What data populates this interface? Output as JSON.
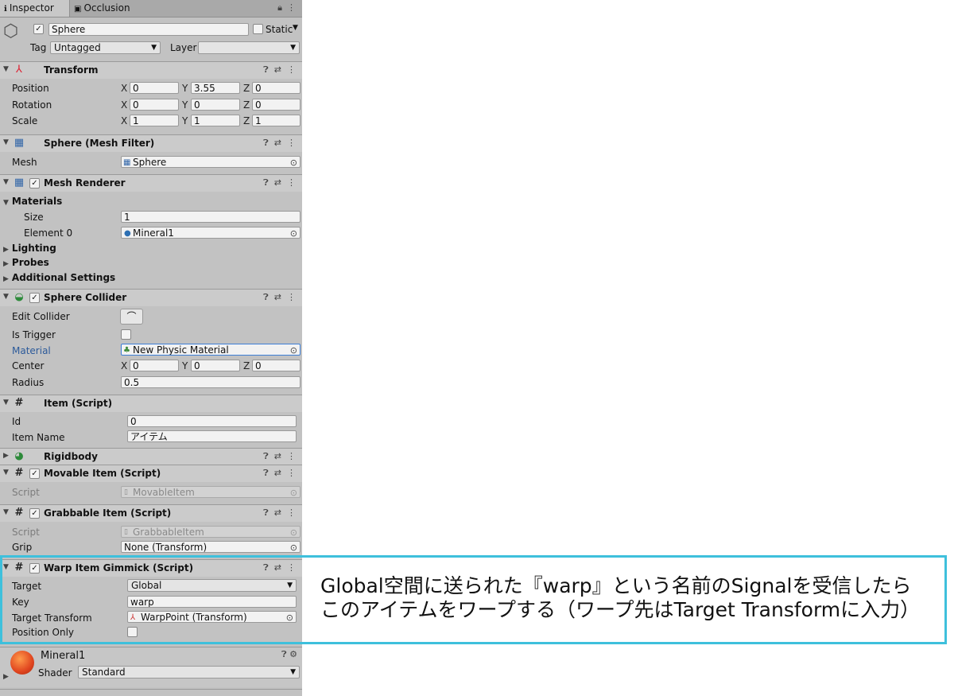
{
  "tabs": {
    "inspector": "Inspector",
    "occlusion": "Occlusion"
  },
  "object": {
    "name": "Sphere",
    "static_label": "Static",
    "tag_label": "Tag",
    "tag_value": "Untagged",
    "layer_label": "Layer",
    "layer_value": ""
  },
  "transform": {
    "title": "Transform",
    "rows": [
      {
        "label": "Position",
        "x": "0",
        "y": "3.55",
        "z": "0"
      },
      {
        "label": "Rotation",
        "x": "0",
        "y": "0",
        "z": "0"
      },
      {
        "label": "Scale",
        "x": "1",
        "y": "1",
        "z": "1"
      }
    ]
  },
  "mesh_filter": {
    "title": "Sphere (Mesh Filter)",
    "mesh_label": "Mesh",
    "mesh_value": "Sphere"
  },
  "mesh_renderer": {
    "title": "Mesh Renderer",
    "materials_label": "Materials",
    "size_label": "Size",
    "size_value": "1",
    "element_label": "Element 0",
    "element_value": "Mineral1",
    "lighting": "Lighting",
    "probes": "Probes",
    "additional": "Additional Settings"
  },
  "sphere_collider": {
    "title": "Sphere Collider",
    "edit_label": "Edit Collider",
    "trigger_label": "Is Trigger",
    "material_label": "Material",
    "material_value": "New Physic Material",
    "center_label": "Center",
    "cx": "0",
    "cy": "0",
    "cz": "0",
    "radius_label": "Radius",
    "radius_value": "0.5"
  },
  "item_script": {
    "title": "Item (Script)",
    "id_label": "Id",
    "id_value": "0",
    "name_label": "Item Name",
    "name_value": "アイテム"
  },
  "rigidbody": {
    "title": "Rigidbody"
  },
  "movable": {
    "title": "Movable Item (Script)",
    "script_label": "Script",
    "script_value": "MovableItem"
  },
  "grabbable": {
    "title": "Grabbable Item (Script)",
    "script_label": "Script",
    "script_value": "GrabbableItem",
    "grip_label": "Grip",
    "grip_value": "None (Transform)"
  },
  "warp": {
    "title": "Warp Item Gimmick (Script)",
    "target_label": "Target",
    "target_value": "Global",
    "key_label": "Key",
    "key_value": "warp",
    "tt_label": "Target Transform",
    "tt_value": "WarpPoint (Transform)",
    "po_label": "Position Only"
  },
  "material": {
    "name": "Mineral1",
    "shader_label": "Shader",
    "shader_value": "Standard"
  },
  "callout": {
    "line1": "Global空間に送られた『warp』という名前のSignalを受信したら",
    "line2": "このアイテムをワープする（ワープ先はTarget Transformに入力）"
  },
  "colors": {
    "panel_bg": "#c2c2c2",
    "callout_border": "#3ec0dc"
  }
}
